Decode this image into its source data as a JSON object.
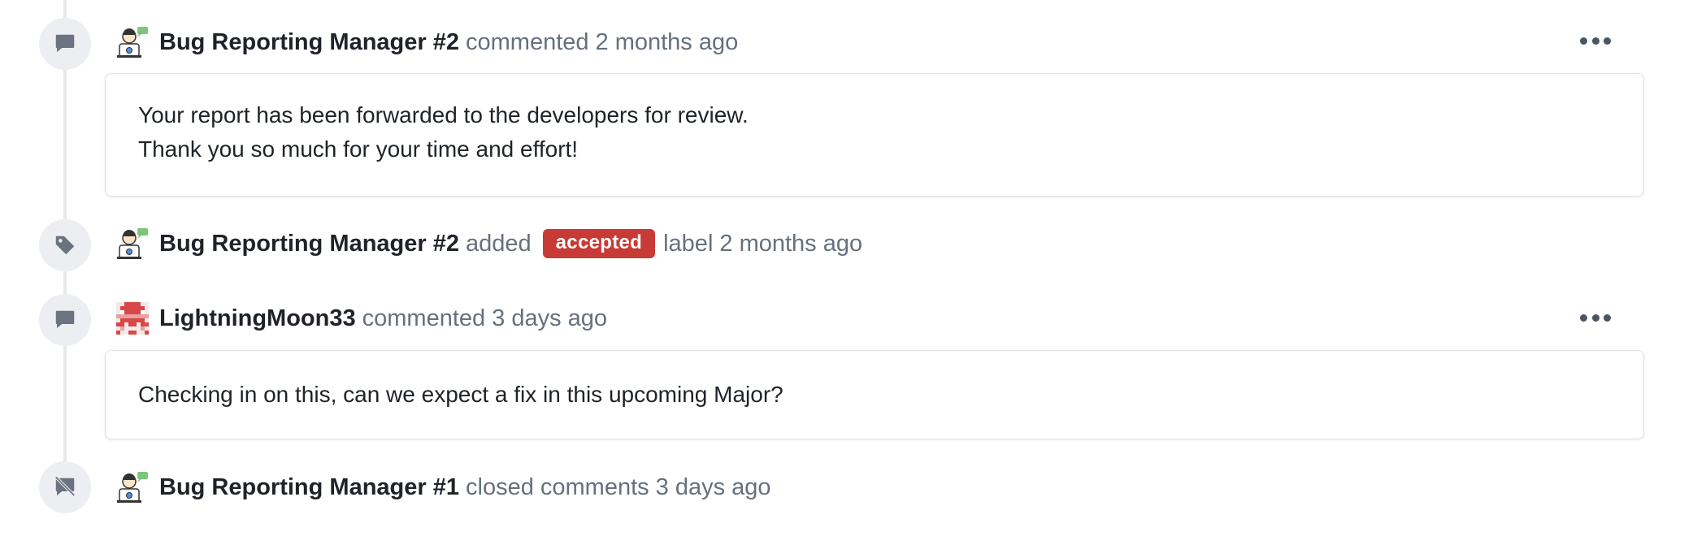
{
  "events": [
    {
      "type": "comment",
      "author": "Bug Reporting Manager #2",
      "action": "commented",
      "time": "2 months ago",
      "body_lines": [
        "Your report has been forwarded to the developers for review.",
        "Thank you so much for your time and effort!"
      ],
      "icon": "comment-icon",
      "avatar": "bug-manager-avatar"
    },
    {
      "type": "label",
      "author": "Bug Reporting Manager #2",
      "action": "added",
      "label": "accepted",
      "after_label": "label",
      "time": "2 months ago",
      "label_color": "#c83a35",
      "icon": "tag-icon",
      "avatar": "bug-manager-avatar"
    },
    {
      "type": "comment",
      "author": "LightningMoon33",
      "action": "commented",
      "time": "3 days ago",
      "body_lines": [
        "Checking in on this, can we expect a fix in this upcoming Major?"
      ],
      "icon": "comment-icon",
      "avatar": "pixel-avatar"
    },
    {
      "type": "lock",
      "author": "Bug Reporting Manager #1",
      "action": "closed comments",
      "time": "3 days ago",
      "icon": "comment-off-icon",
      "avatar": "bug-manager-avatar"
    }
  ],
  "colors": {
    "accent_label": "#c83a35",
    "muted": "#66707d",
    "icon_bg": "#eceef1"
  }
}
